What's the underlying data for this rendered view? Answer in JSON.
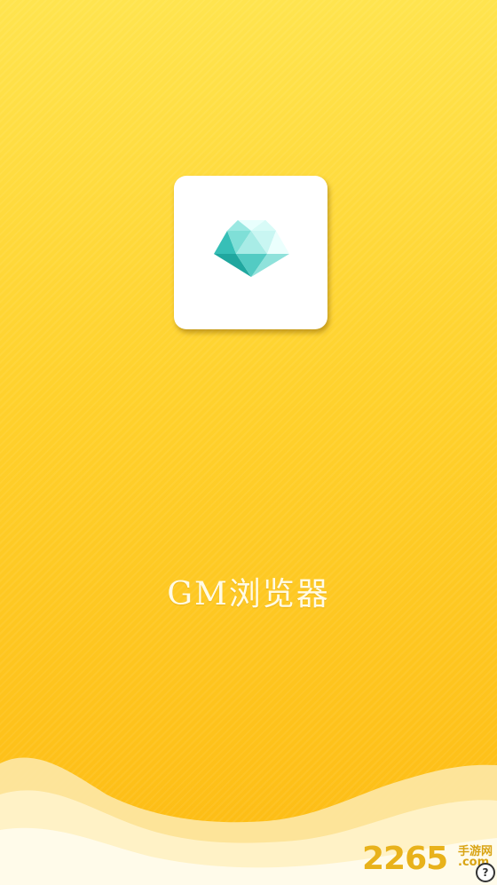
{
  "app": {
    "name": "GM浏览器"
  },
  "logo": {
    "icon": "diamond-icon"
  },
  "watermark": {
    "number": "2265",
    "text": "手游网",
    "domain": ".com"
  },
  "help": {
    "glyph": "?"
  },
  "colors": {
    "background_top": "#ffe44e",
    "background_bottom": "#fdbb13",
    "card": "#ffffff",
    "diamond": "#5fd6cc",
    "app_name": "#fffbe6",
    "watermark": "#e8b21b"
  }
}
